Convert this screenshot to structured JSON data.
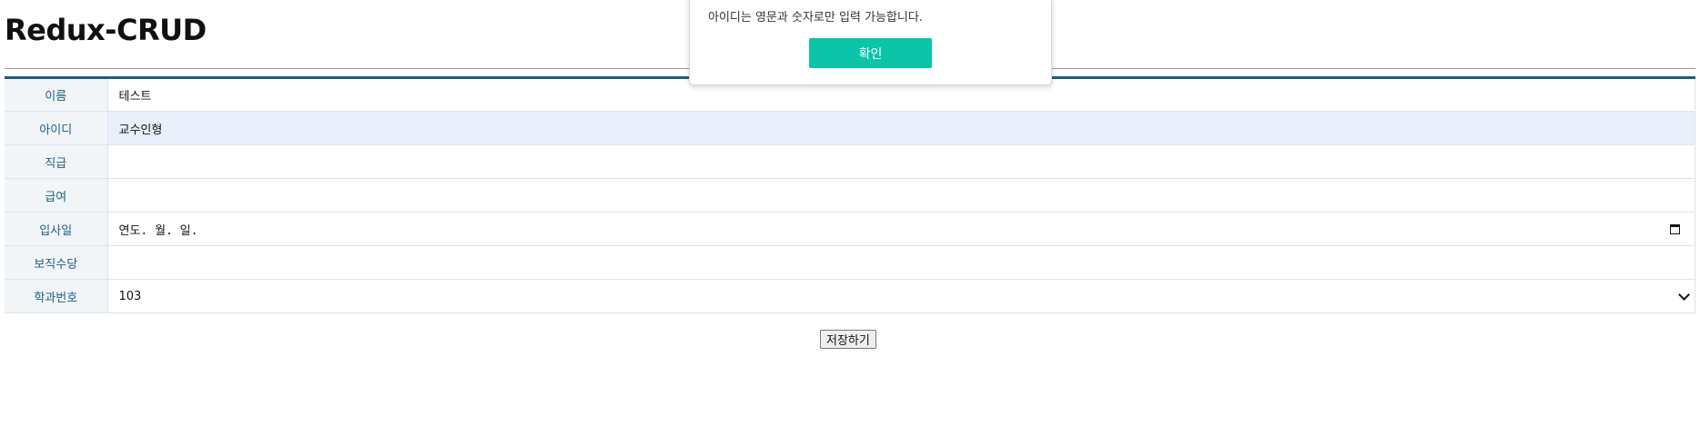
{
  "app": {
    "title": "Redux-CRUD"
  },
  "form": {
    "rows": [
      {
        "label": "이름",
        "value": "테스트"
      },
      {
        "label": "아이디",
        "value": "교수인형"
      },
      {
        "label": "직급",
        "value": ""
      },
      {
        "label": "급여",
        "value": ""
      },
      {
        "label": "입사일",
        "value": "연도. 월. 일."
      },
      {
        "label": "보직수당",
        "value": ""
      },
      {
        "label": "학과번호",
        "value": "103"
      }
    ],
    "save_label": "저장하기"
  },
  "alert": {
    "message": "아이디는 영문과 숫자로만 입력 가능합니다.",
    "confirm_label": "확인"
  },
  "colors": {
    "header_rule": "#1c5d82",
    "label_text": "#1f5f7e",
    "focused_row": "#e9f0fb",
    "confirm_button": "#0cc4a7"
  },
  "icons": {
    "date_picker": "calendar-icon",
    "select_arrow": "chevron-down-icon"
  }
}
